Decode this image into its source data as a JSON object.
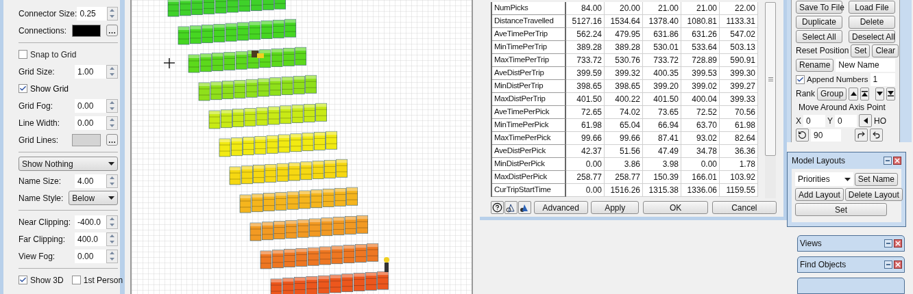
{
  "left_panel": {
    "rows": [
      {
        "kind": "spinner",
        "label": "Connector Size:",
        "value": "0.25"
      },
      {
        "kind": "swatch",
        "label": "Connections:",
        "color": "#000000"
      },
      {
        "kind": "divider"
      },
      {
        "kind": "checkbox",
        "label": "Snap to Grid",
        "checked": false
      },
      {
        "kind": "spinner",
        "label": "Grid Size:",
        "value": "1.00"
      },
      {
        "kind": "checkbox",
        "label": "Show Grid",
        "checked": true
      },
      {
        "kind": "spinner",
        "label": "Grid Fog:",
        "value": "0.00"
      },
      {
        "kind": "spinner",
        "label": "Line Width:",
        "value": "0.00"
      },
      {
        "kind": "swatch",
        "label": "Grid Lines:",
        "color": "#d4d4d4"
      },
      {
        "kind": "divider"
      },
      {
        "kind": "dropdown",
        "value": "Show Nothing"
      },
      {
        "kind": "spinner",
        "label": "Name Size:",
        "value": "4.00"
      },
      {
        "kind": "dropdown",
        "label": "Name Style:",
        "value": "Below"
      },
      {
        "kind": "divider"
      },
      {
        "kind": "spinner",
        "label": "Near Clipping:",
        "value": "-400.0"
      },
      {
        "kind": "spinner",
        "label": "Far Clipping:",
        "value": "400.0"
      },
      {
        "kind": "spinner",
        "label": "View Fog:",
        "value": "0.00"
      },
      {
        "kind": "divider"
      },
      {
        "kind": "checkbox_pair",
        "items": [
          {
            "label": "Show 3D",
            "checked": true
          },
          {
            "label": "1st Person",
            "checked": false
          }
        ]
      }
    ]
  },
  "stats_table": {
    "rows": [
      {
        "name": "NumPicks",
        "values": [
          "84.00",
          "20.00",
          "21.00",
          "21.00",
          "22.00"
        ]
      },
      {
        "name": "DistanceTravelled",
        "values": [
          "5127.16",
          "1534.64",
          "1378.40",
          "1080.81",
          "1133.31"
        ]
      },
      {
        "name": "AveTimePerTrip",
        "values": [
          "562.24",
          "479.95",
          "631.86",
          "631.26",
          "547.02"
        ]
      },
      {
        "name": "MinTimePerTrip",
        "values": [
          "389.28",
          "389.28",
          "530.01",
          "533.64",
          "503.13"
        ]
      },
      {
        "name": "MaxTimePerTrip",
        "values": [
          "733.72",
          "530.76",
          "733.72",
          "728.89",
          "590.91"
        ]
      },
      {
        "name": "AveDistPerTrip",
        "values": [
          "399.59",
          "399.32",
          "400.35",
          "399.53",
          "399.30"
        ]
      },
      {
        "name": "MinDistPerTrip",
        "values": [
          "398.65",
          "398.65",
          "399.20",
          "399.02",
          "399.27"
        ]
      },
      {
        "name": "MaxDistPerTrip",
        "values": [
          "401.50",
          "400.22",
          "401.50",
          "400.04",
          "399.33"
        ]
      },
      {
        "name": "AveTimePerPick",
        "values": [
          "72.65",
          "74.02",
          "73.65",
          "72.52",
          "70.56"
        ]
      },
      {
        "name": "MinTimePerPick",
        "values": [
          "61.98",
          "65.04",
          "66.94",
          "63.70",
          "61.98"
        ]
      },
      {
        "name": "MaxTimePerPick",
        "values": [
          "99.66",
          "99.66",
          "87.41",
          "93.02",
          "82.64"
        ]
      },
      {
        "name": "AveDistPerPick",
        "values": [
          "42.37",
          "51.56",
          "47.49",
          "34.78",
          "36.36"
        ]
      },
      {
        "name": "MinDistPerPick",
        "values": [
          "0.00",
          "3.86",
          "3.98",
          "0.00",
          "1.78"
        ]
      },
      {
        "name": "MaxDistPerPick",
        "values": [
          "258.77",
          "258.77",
          "150.39",
          "166.01",
          "103.92"
        ]
      },
      {
        "name": "CurTripStartTime",
        "values": [
          "0.00",
          "1516.26",
          "1315.38",
          "1336.06",
          "1159.55"
        ]
      }
    ]
  },
  "dialog_buttons": [
    "Advanced",
    "Apply",
    "OK",
    "Cancel"
  ],
  "edit_panel": {
    "button_rows": [
      [
        "Save To File",
        "Load File"
      ],
      [
        "Duplicate",
        "Delete"
      ],
      [
        "Select All",
        "Deselect All"
      ]
    ],
    "reset_position": {
      "label": "Reset Position",
      "buttons": [
        "Set",
        "Clear"
      ]
    },
    "rename": {
      "button": "Rename",
      "value": "New Name"
    },
    "append_numbers": {
      "label": "Append Numbers",
      "checked": true,
      "value": "1"
    },
    "rank": {
      "label": "Rank",
      "button": "Group"
    },
    "axis": {
      "title": "Move Around Axis Point",
      "x_label": "X",
      "x_value": "0",
      "y_label": "Y",
      "y_value": "0",
      "ho_label": "HO",
      "angle": "90"
    }
  },
  "model_layouts": {
    "title": "Model Layouts",
    "dropdown": "Priorities",
    "set_name": "Set Name",
    "buttons": [
      "Add Layout",
      "Delete Layout"
    ],
    "set": "Set"
  },
  "docked_panels": [
    {
      "title": "Views"
    },
    {
      "title": "Find Objects"
    }
  ]
}
